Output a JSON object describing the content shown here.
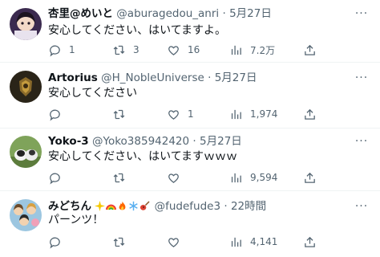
{
  "tweets": [
    {
      "name": "杏里@めいと",
      "handle": "@aburagedou_anri",
      "dot": "·",
      "time": "5月27日",
      "text": "安心してください、はいてますよ。",
      "replies": "1",
      "retweets": "3",
      "likes": "16",
      "views": "7.2万",
      "avatar_color": "#3b2a4f"
    },
    {
      "name": "Artorius",
      "handle": "@H_NobleUniverse",
      "dot": "·",
      "time": "5月27日",
      "text": "安心してください",
      "replies": "",
      "retweets": "",
      "likes": "1",
      "views": "1,974",
      "avatar_color": "#2a2418"
    },
    {
      "name": "Yoko-3",
      "handle": "@Yoko385942420",
      "dot": "·",
      "time": "5月27日",
      "text": "安心してください、はいてますｗｗｗ",
      "replies": "",
      "retweets": "",
      "likes": "",
      "views": "9,594",
      "avatar_color": "#7fa35a"
    },
    {
      "name": "みどちん",
      "name_emojis": [
        "sparkles",
        "rainbow",
        "fire",
        "snowflake",
        "guitar"
      ],
      "handle": "@fudefude3",
      "dot": "·",
      "time": "22時間",
      "text": "パーンツ！",
      "replies": "",
      "retweets": "",
      "likes": "",
      "views": "4,141",
      "avatar_color": "#9cc6e0"
    }
  ],
  "more_label": "···",
  "icons": [
    "reply-icon",
    "retweet-icon",
    "like-icon",
    "views-icon",
    "share-icon",
    "more-icon"
  ]
}
